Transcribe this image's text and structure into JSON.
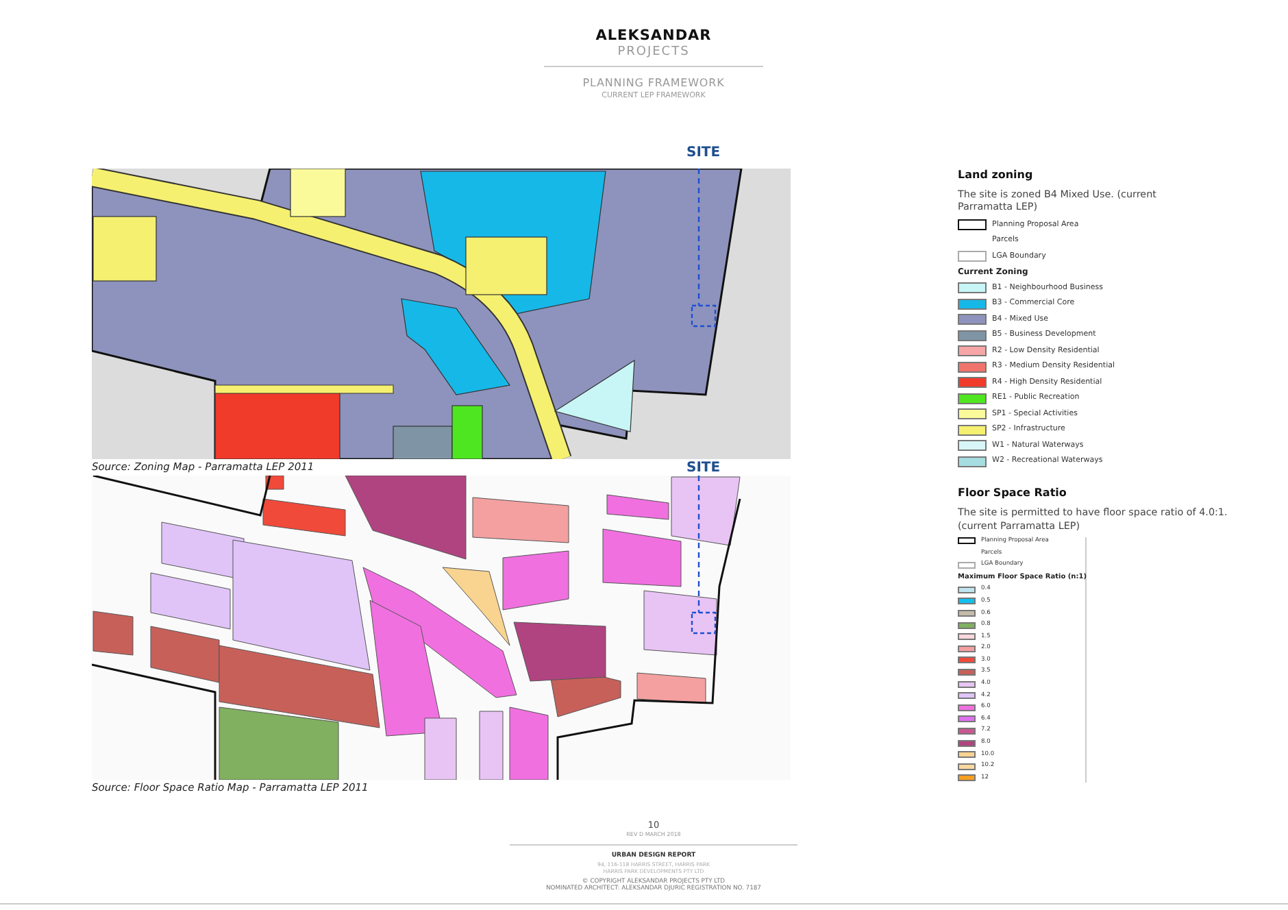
{
  "header": {
    "brand": "ALEKSANDAR",
    "brand_sub": "PROJECTS",
    "title": "PLANNING FRAMEWORK",
    "subtitle": "CURRENT LEP FRAMEWORK"
  },
  "maps": [
    {
      "kind": "zoning",
      "site_label": "SITE",
      "caption": "Source: Zoning Map - Parramatta LEP 2011"
    },
    {
      "kind": "fsr",
      "site_label": "SITE",
      "caption": "Source: Floor Space Ratio Map - Parramatta LEP 2011"
    }
  ],
  "legends": [
    {
      "kind": "zoning",
      "heading": "Land zoning",
      "description": "The site is zoned B4 Mixed Use. (current Parramatta LEP)",
      "base": [
        {
          "kind": "proposal",
          "label": "Planning Proposal Area"
        },
        {
          "kind": "parcels",
          "label": "Parcels"
        },
        {
          "kind": "lga",
          "label": "LGA Boundary"
        }
      ],
      "group_title": "Current Zoning",
      "items": [
        {
          "label": "B1 - Neighbourhood Business",
          "color": "#c8f5f5"
        },
        {
          "label": "B3 - Commercial Core",
          "color": "#16b8e8"
        },
        {
          "label": "B4 - Mixed Use",
          "color": "#8e93bd"
        },
        {
          "label": "B5 - Business Development",
          "color": "#7f95a5"
        },
        {
          "label": "R2 - Low Density Residential",
          "color": "#f6a6a6"
        },
        {
          "label": "R3 - Medium Density Residential",
          "color": "#f0746c"
        },
        {
          "label": "R4 - High Density Residential",
          "color": "#f03a2a"
        },
        {
          "label": "RE1 - Public Recreation",
          "color": "#4ee620"
        },
        {
          "label": "SP1 - Special Activities",
          "color": "#fbfa9b"
        },
        {
          "label": "SP2 - Infrastructure",
          "color": "#f5f070"
        },
        {
          "label": "W1 - Natural Waterways",
          "color": "#d8f6f7"
        },
        {
          "label": "W2 - Recreational Waterways",
          "color": "#a6dde0"
        }
      ]
    },
    {
      "kind": "fsr",
      "heading": "Floor Space Ratio",
      "description": "The site is permitted to have floor space ratio of 4.0:1. (current Parramatta LEP)",
      "base": [
        {
          "kind": "proposal",
          "label": "Planning Proposal Area"
        },
        {
          "kind": "parcels",
          "label": "Parcels"
        },
        {
          "kind": "lga",
          "label": "LGA Boundary"
        }
      ],
      "group_title": "Maximum Floor Space Ratio (n:1)",
      "items": [
        {
          "label": "0.4",
          "color": "#bfe6ee"
        },
        {
          "label": "0.5",
          "color": "#10c0f0"
        },
        {
          "label": "0.6",
          "color": "#c4bca8"
        },
        {
          "label": "0.8",
          "color": "#80b060"
        },
        {
          "label": "1.5",
          "color": "#fad8dc"
        },
        {
          "label": "2.0",
          "color": "#f4a0a0"
        },
        {
          "label": "3.0",
          "color": "#f04a3a"
        },
        {
          "label": "3.5",
          "color": "#c8605a"
        },
        {
          "label": "4.0",
          "color": "#e8c4f4"
        },
        {
          "label": "4.2",
          "color": "#e0c4f8"
        },
        {
          "label": "6.0",
          "color": "#f070e0"
        },
        {
          "label": "6.4",
          "color": "#e070f0"
        },
        {
          "label": "7.2",
          "color": "#c85890"
        },
        {
          "label": "8.0",
          "color": "#b04480"
        },
        {
          "label": "10.0",
          "color": "#f8d490"
        },
        {
          "label": "10.2",
          "color": "#f8d8a0"
        },
        {
          "label": "12",
          "color": "#f8a020"
        }
      ]
    }
  ],
  "footer": {
    "page": "10",
    "revision": "REV D MARCH 2018",
    "report": "URBAN DESIGN REPORT",
    "address_lines": [
      "94, 116-118 HARRIS STREET, HARRIS PARK",
      "HARRIS PARK DEVELOPMENTS PTY LTD"
    ],
    "copyright_lines": [
      "© COPYRIGHT ALEKSANDAR PROJECTS PTY LTD",
      "NOMINATED ARCHITECT: ALEKSANDAR DJURIC REGISTRATION NO. 7187"
    ]
  }
}
